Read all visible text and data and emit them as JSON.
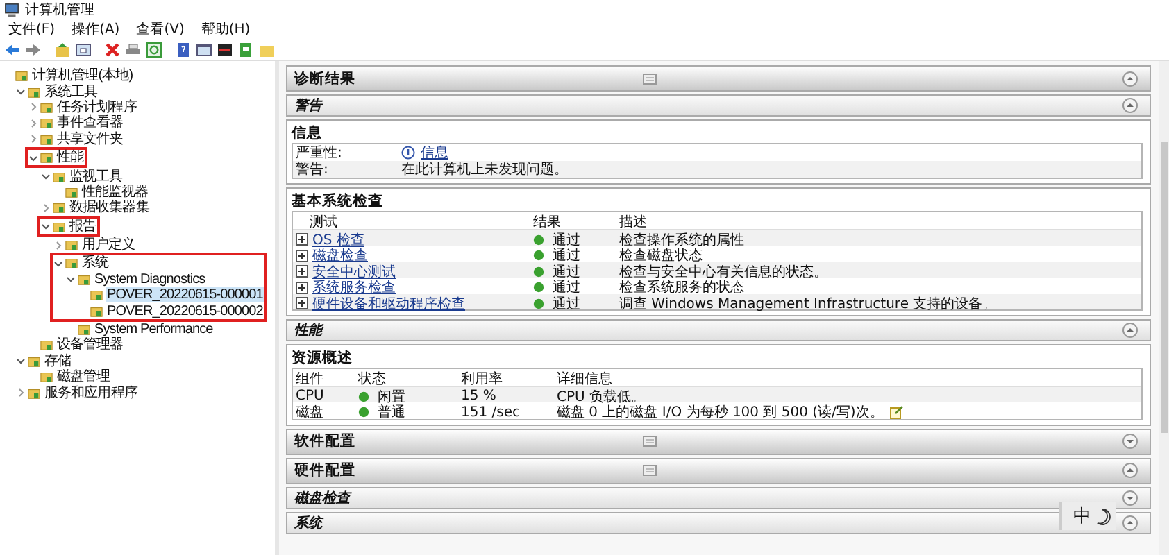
{
  "window": {
    "title": "计算机管理"
  },
  "menu": [
    "文件(F)",
    "操作(A)",
    "查看(V)",
    "帮助(H)"
  ],
  "tree": [
    {
      "label": "计算机管理(本地)",
      "children": [
        {
          "label": "系统工具",
          "expanded": true,
          "children": [
            {
              "label": "任务计划程序",
              "expanded": false
            },
            {
              "label": "事件查看器",
              "expanded": false
            },
            {
              "label": "共享文件夹",
              "expanded": false
            },
            {
              "label": "性能",
              "expanded": true,
              "outlined": true,
              "children": [
                {
                  "label": "监视工具",
                  "expanded": true,
                  "children": [
                    {
                      "label": "性能监视器"
                    }
                  ]
                },
                {
                  "label": "数据收集器集",
                  "expanded": false
                },
                {
                  "label": "报告",
                  "expanded": true,
                  "outlined": true,
                  "children": [
                    {
                      "label": "用户定义",
                      "expanded": false
                    },
                    {
                      "label": "系统",
                      "expanded": true,
                      "outlined": true,
                      "children": [
                        {
                          "label": "System Diagnostics",
                          "expanded": true,
                          "outlined": true,
                          "children": [
                            {
                              "label": "POVER_20220615-000001",
                              "selected": true,
                              "outlined": true
                            },
                            {
                              "label": "POVER_20220615-000002",
                              "selected": false,
                              "outlined": true
                            }
                          ]
                        },
                        {
                          "label": "System Performance"
                        }
                      ]
                    }
                  ]
                }
              ]
            },
            {
              "label": "设备管理器"
            }
          ]
        },
        {
          "label": "存储",
          "expanded": true,
          "children": [
            {
              "label": "磁盘管理"
            }
          ]
        },
        {
          "label": "服务和应用程序",
          "expanded": false
        }
      ]
    }
  ],
  "sections": [
    {
      "kind": "header",
      "title": "诊断结果",
      "expanded": true
    },
    {
      "kind": "subheader",
      "title": "警告",
      "expanded": true
    },
    {
      "kind": "info",
      "title": "信息",
      "rows": [
        {
          "kind": "severity",
          "label": "严重性:",
          "value": "信息"
        },
        {
          "kind": "text",
          "label": "警告:",
          "value": "在此计算机上未发现问题。"
        }
      ]
    },
    {
      "kind": "table",
      "title": "基本系统检查",
      "expandable": true,
      "columns": [
        "测试",
        "结果",
        "描述"
      ],
      "rows": [
        {
          "cells": [
            "OS 检查",
            "通过",
            "检查操作系统的属性"
          ],
          "color": "#3aa12f"
        },
        {
          "cells": [
            "磁盘检查",
            "通过",
            "检查磁盘状态"
          ],
          "color": "#3aa12f"
        },
        {
          "cells": [
            "安全中心测试",
            "通过",
            "检查与安全中心有关信息的状态。"
          ],
          "color": "#3aa12f"
        },
        {
          "cells": [
            "系统服务检查",
            "通过",
            "检查系统服务的状态"
          ],
          "color": "#3aa12f"
        },
        {
          "cells": [
            "硬件设备和驱动程序检查",
            "通过",
            "调查 Windows Management Infrastructure 支持的设备。"
          ],
          "color": "#3aa12f"
        }
      ]
    },
    {
      "kind": "subheader",
      "title": "性能",
      "expanded": true
    },
    {
      "kind": "table",
      "title": "资源概述",
      "expandable": false,
      "columns": [
        "组件",
        "状态",
        "利用率",
        "详细信息"
      ],
      "rows": [
        {
          "cells": [
            "CPU",
            "闲置",
            "15 %",
            "CPU 负载低。"
          ],
          "color": "#3aa12f",
          "note": false
        },
        {
          "cells": [
            "磁盘",
            "普通",
            "151 /sec",
            "磁盘 0 上的磁盘 I/O 为每秒 100 到 500 (读/写)次。"
          ],
          "color": "#3aa12f",
          "note": true
        }
      ]
    },
    {
      "kind": "header",
      "title": "软件配置",
      "expanded": false
    },
    {
      "kind": "header",
      "title": "硬件配置",
      "expanded": true
    },
    {
      "kind": "subheader",
      "title": "磁盘检查",
      "expanded": false
    },
    {
      "kind": "subheader",
      "title": "系统",
      "expanded": true
    }
  ],
  "ime": {
    "text": "中"
  }
}
